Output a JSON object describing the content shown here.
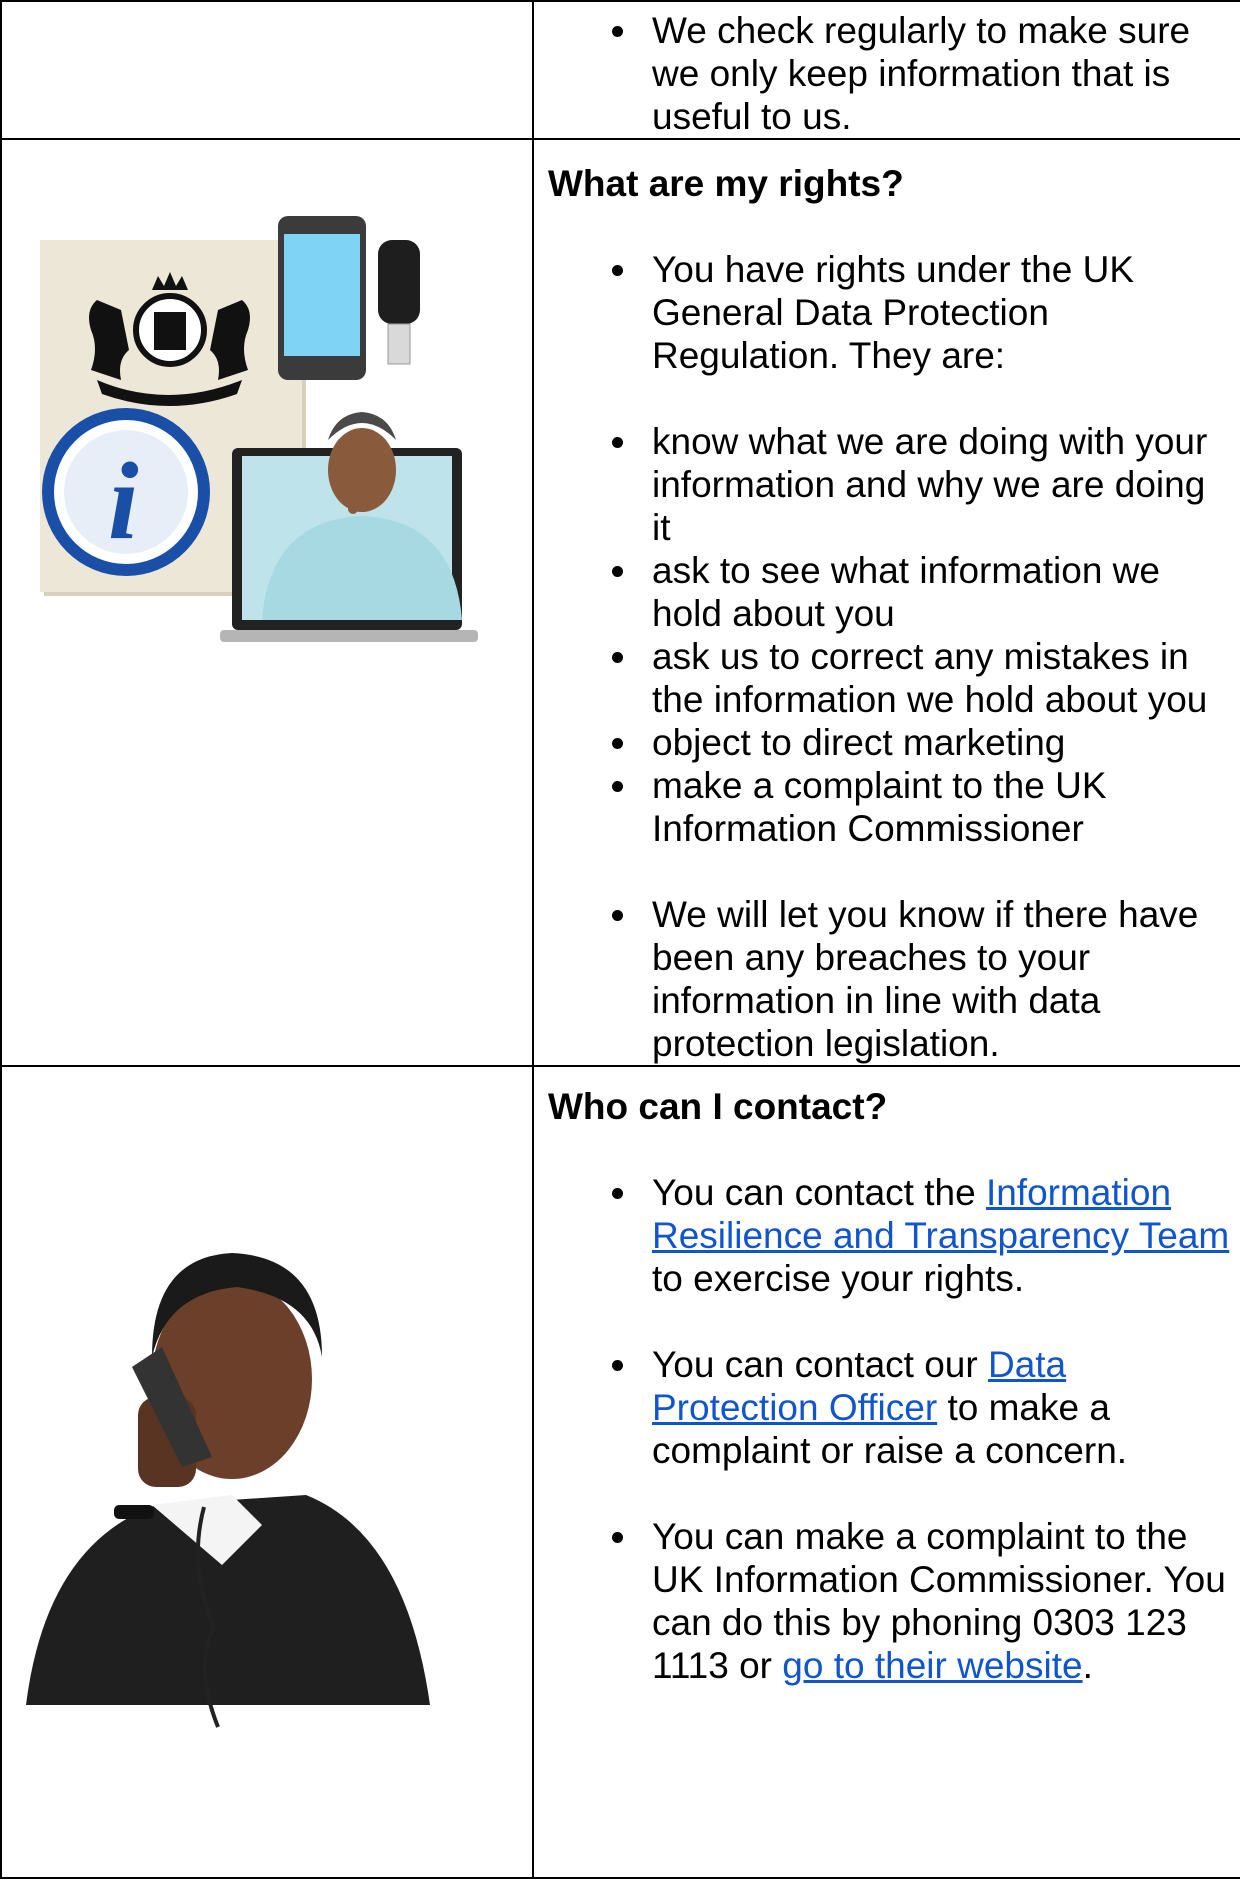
{
  "row1": {
    "bullets": [
      "We check regularly to make sure we only keep information that is useful to us."
    ]
  },
  "rights": {
    "heading": "What are my rights?",
    "intro": "You have rights under the UK General Data Protection Regulation. They are:",
    "list": [
      "know what we are doing with your information and why we are doing it",
      "ask to see what information we hold about you",
      "ask us to correct any mistakes in the information we hold about you",
      "object to direct marketing",
      "make a complaint to the UK Information Commissioner"
    ],
    "breaches": "We will let you know if there have been any breaches to your information in line with data protection legislation."
  },
  "contact": {
    "heading": "Who can I contact?",
    "item1_pre": "You can contact the ",
    "item1_link": "Information Resilience and Transparency Team",
    "item1_post": " to exercise your rights.",
    "item2_pre": "You can contact our ",
    "item2_link": "Data Protection Officer",
    "item2_post": " to make a complaint or raise a concern.",
    "item3_pre": "You can make a complaint to the UK Information Commissioner. You can do this by phoning 0303 123 1113 or ",
    "item3_link": "go to their website",
    "item3_post": "."
  },
  "colors": {
    "link": "#1155cc",
    "border": "#000000"
  },
  "icons": [
    "royal-coat-of-arms-icon",
    "information-icon",
    "smartphone-icon",
    "usb-stick-icon",
    "laptop-icon",
    "person-shh-photo",
    "person-on-phone-photo"
  ]
}
